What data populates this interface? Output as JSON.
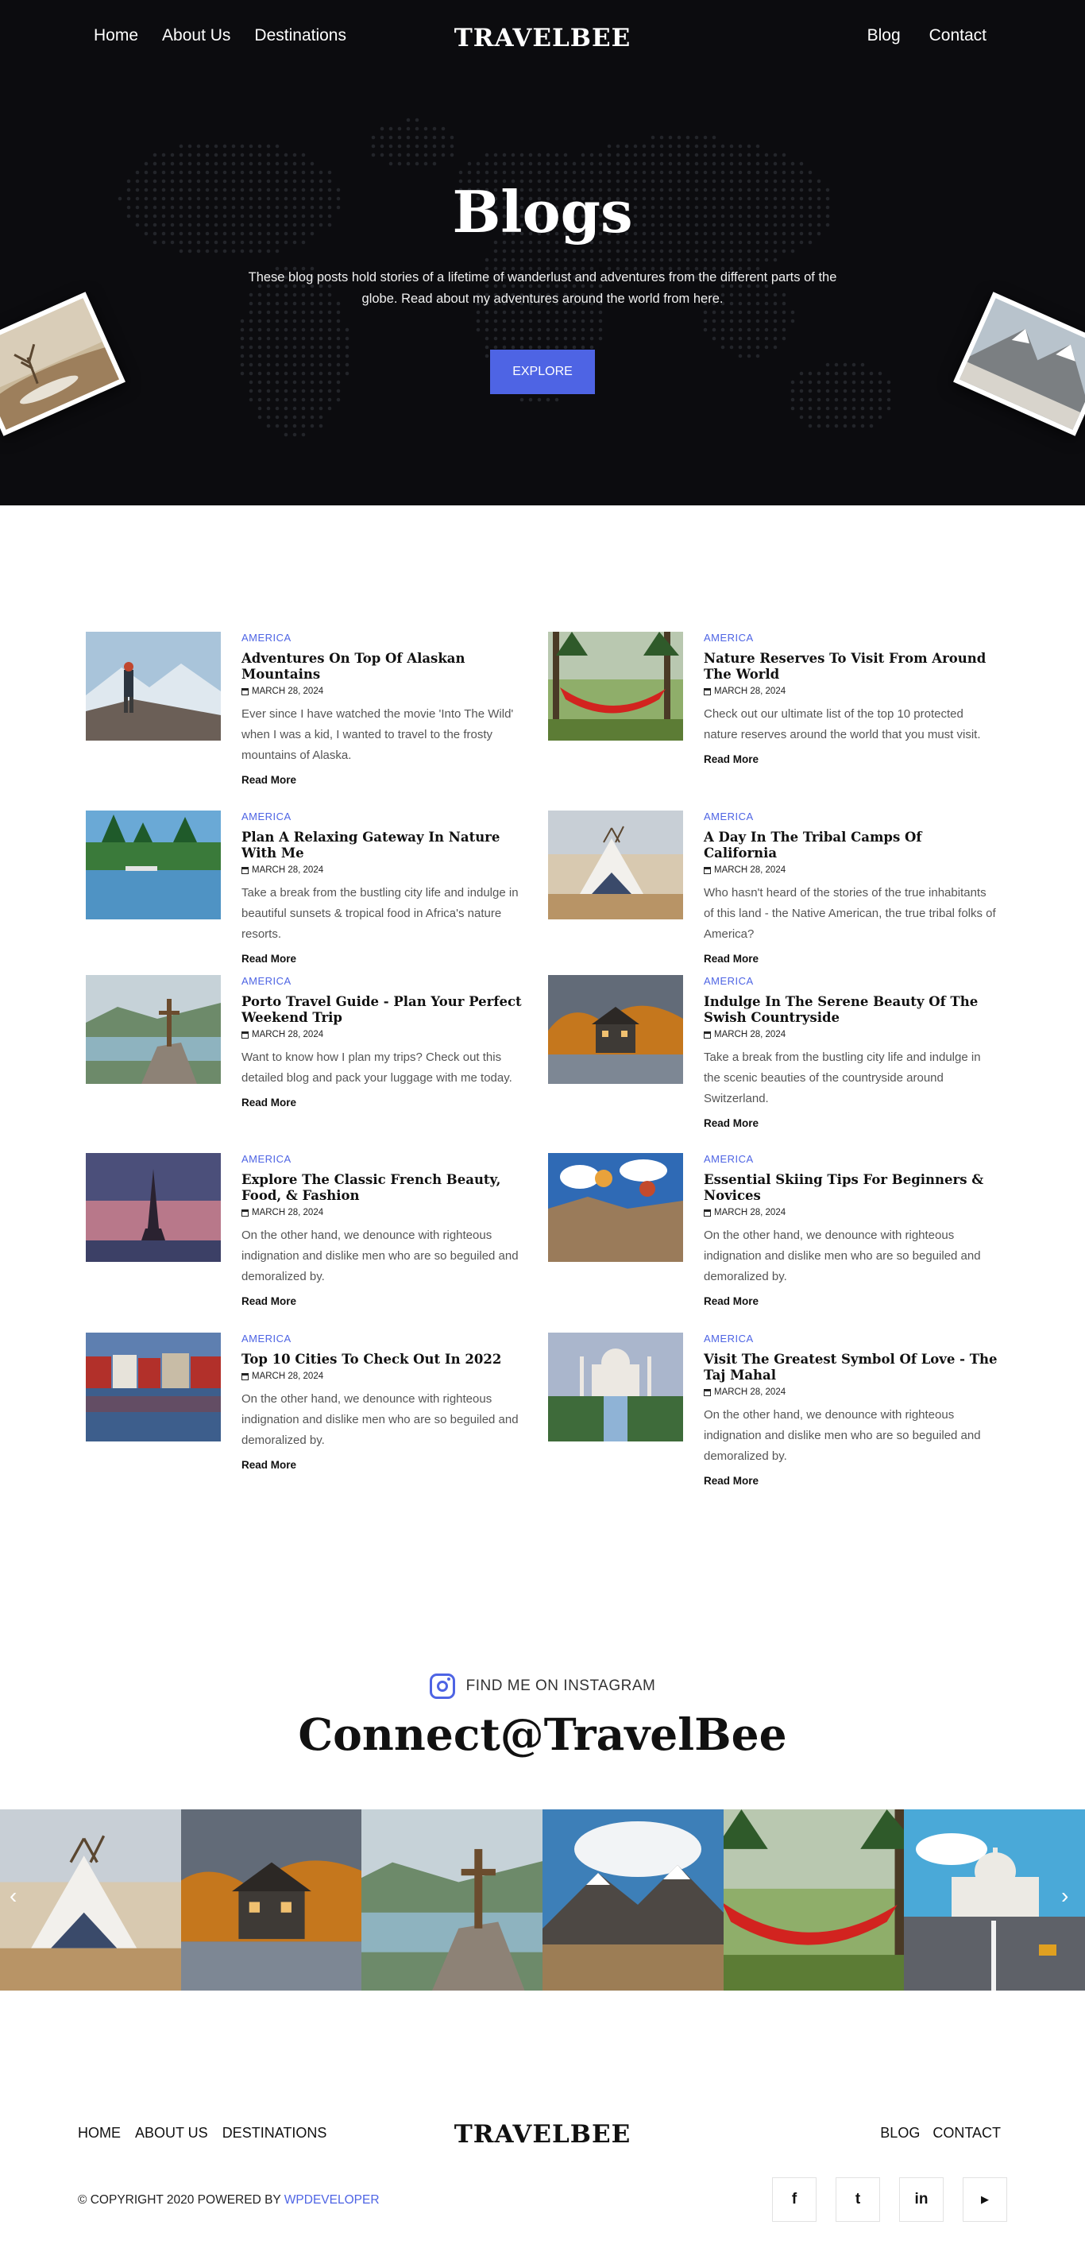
{
  "nav": {
    "left": [
      "Home",
      "About Us",
      "Destinations"
    ],
    "right": [
      "Blog",
      "Contact"
    ],
    "logo": "TRAVELBEE"
  },
  "hero": {
    "title": "Blogs",
    "subtitle": "These blog posts hold stories of a lifetime of wanderlust and adventures from the different parts of the globe. Read about my adventures around the world from here.",
    "button": "EXPLORE"
  },
  "posts": [
    {
      "category": "AMERICA",
      "title": "Adventures On Top Of Alaskan Mountains",
      "date": "MARCH 28, 2024",
      "excerpt": "Ever since I have watched the movie 'Into The Wild' when I was a kid, I wanted to travel to the frosty mountains of Alaska.",
      "read_more": "Read More",
      "image": "mountain-hiker"
    },
    {
      "category": "AMERICA",
      "title": "Nature Reserves To Visit From Around The World",
      "date": "MARCH 28, 2024",
      "excerpt": "Check out our ultimate list of the top 10 protected nature reserves around the world that you must visit.",
      "read_more": "Read More",
      "image": "hammock-forest"
    },
    {
      "category": "AMERICA",
      "title": "Plan A Relaxing Gateway In Nature With Me",
      "date": "MARCH 28, 2024",
      "excerpt": "Take a break from the bustling city life and indulge in beautiful sunsets & tropical food in Africa's nature resorts.",
      "read_more": "Read More",
      "image": "lake-trees"
    },
    {
      "category": "AMERICA",
      "title": "A Day In The Tribal Camps Of California",
      "date": "MARCH 28, 2024",
      "excerpt": "Who hasn't heard of the stories of the true inhabitants of this land - the Native American, the true tribal folks of America?",
      "read_more": "Read More",
      "image": "teepees"
    },
    {
      "category": "AMERICA",
      "title": "Porto Travel Guide - Plan Your Perfect Weekend Trip",
      "date": "MARCH 28, 2024",
      "excerpt": "Want to know how I plan my trips? Check out this detailed blog and pack your luggage with me today.",
      "read_more": "Read More",
      "image": "cross-cliff"
    },
    {
      "category": "AMERICA",
      "title": "Indulge In The Serene Beauty Of The Swish Countryside",
      "date": "MARCH 28, 2024",
      "excerpt": "Take a break from the bustling city life and indulge in the scenic beauties of the countryside around Switzerland.",
      "read_more": "Read More",
      "image": "autumn-house"
    },
    {
      "category": "AMERICA",
      "title": "Explore The Classic French Beauty, Food, & Fashion",
      "date": "MARCH 28, 2024",
      "excerpt": "On the other hand, we denounce with righteous indignation and dislike men who are so beguiled and demoralized by.",
      "read_more": "Read More",
      "image": "eiffel-tower"
    },
    {
      "category": "AMERICA",
      "title": "Essential Skiing Tips For Beginners & Novices",
      "date": "MARCH 28, 2024",
      "excerpt": "On the other hand, we denounce with righteous indignation and dislike men who are so beguiled and demoralized by.",
      "read_more": "Read More",
      "image": "balloons-valley"
    },
    {
      "category": "AMERICA",
      "title": "Top 10 Cities To Check Out In 2022",
      "date": "MARCH 28, 2024",
      "excerpt": "On the other hand, we denounce with righteous indignation and dislike men who are so beguiled and demoralized by.",
      "read_more": "Read More",
      "image": "harbor-houses"
    },
    {
      "category": "AMERICA",
      "title": "Visit The Greatest Symbol Of Love - The Taj Mahal",
      "date": "MARCH 28, 2024",
      "excerpt": "On the other hand, we denounce with righteous indignation and dislike men who are so beguiled and demoralized by.",
      "read_more": "Read More",
      "image": "taj-mahal"
    }
  ],
  "instagram": {
    "label": "FIND ME ON INSTAGRAM",
    "handle": "Connect@TravelBee",
    "prev": "‹",
    "next": "›",
    "images": [
      "teepees",
      "autumn-house",
      "cross-cliff",
      "mountain-valley",
      "hammock-forest",
      "capitol-street"
    ]
  },
  "footer": {
    "left": [
      "HOME",
      "ABOUT US",
      "DESTINATIONS"
    ],
    "right": [
      "BLOG",
      "CONTACT"
    ],
    "logo": "TRAVELBEE",
    "copyright": "© COPYRIGHT 2020 POWERED BY",
    "powered_by": "WPDEVELOPER",
    "socials": [
      {
        "icon": "facebook-icon",
        "glyph": "f"
      },
      {
        "icon": "twitter-icon",
        "glyph": "t"
      },
      {
        "icon": "linkedin-icon",
        "glyph": "in"
      },
      {
        "icon": "youtube-icon",
        "glyph": "▶"
      }
    ]
  },
  "colors": {
    "accent": "#4e64e4",
    "hero_bg": "#0c0c0f"
  }
}
